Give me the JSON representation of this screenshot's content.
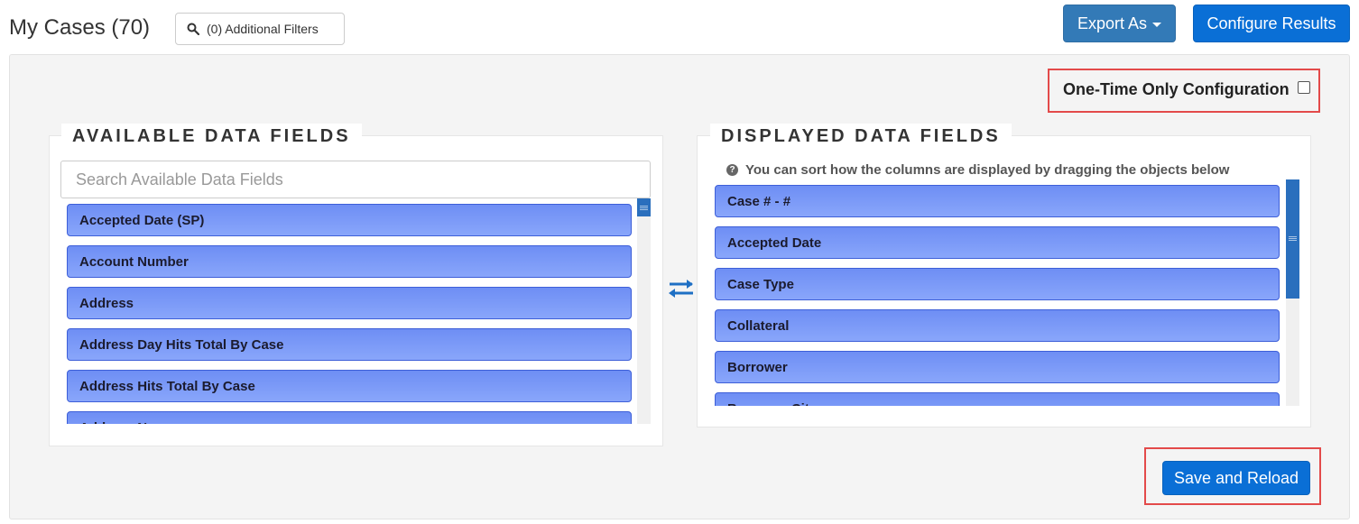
{
  "header": {
    "title": "My Cases (70)",
    "filters_label": "(0) Additional Filters",
    "export_label": "Export As",
    "configure_label": "Configure Results"
  },
  "config": {
    "one_time_label": "One-Time Only Configuration",
    "one_time_checked": false
  },
  "available": {
    "legend": "AVAILABLE DATA FIELDS",
    "search_placeholder": "Search Available Data Fields",
    "items": [
      {
        "label": "Accepted Date (SP)"
      },
      {
        "label": "Account Number"
      },
      {
        "label": "Address"
      },
      {
        "label": "Address Day Hits Total By Case"
      },
      {
        "label": "Address Hits Total By Case"
      },
      {
        "label": "Address Name"
      }
    ]
  },
  "displayed": {
    "legend": "DISPLAYED DATA FIELDS",
    "hint": "You can sort how the columns are displayed by dragging the objects below",
    "items": [
      {
        "label": "Case # - #"
      },
      {
        "label": "Accepted Date"
      },
      {
        "label": "Case Type"
      },
      {
        "label": "Collateral"
      },
      {
        "label": "Borrower"
      },
      {
        "label": "Borrower City"
      }
    ]
  },
  "footer": {
    "save_label": "Save and Reload"
  },
  "colors": {
    "primary_button": "#0a6fd6",
    "export_button": "#337ab7",
    "item_fill": "#7f9cf8",
    "highlight_box": "#e34a4a",
    "scroll_thumb": "#2a6fbd"
  },
  "icons": {
    "filters": "search-icon",
    "export": "caret-down-icon",
    "swap": "swap-arrows-icon",
    "hint": "question-circle-icon"
  }
}
